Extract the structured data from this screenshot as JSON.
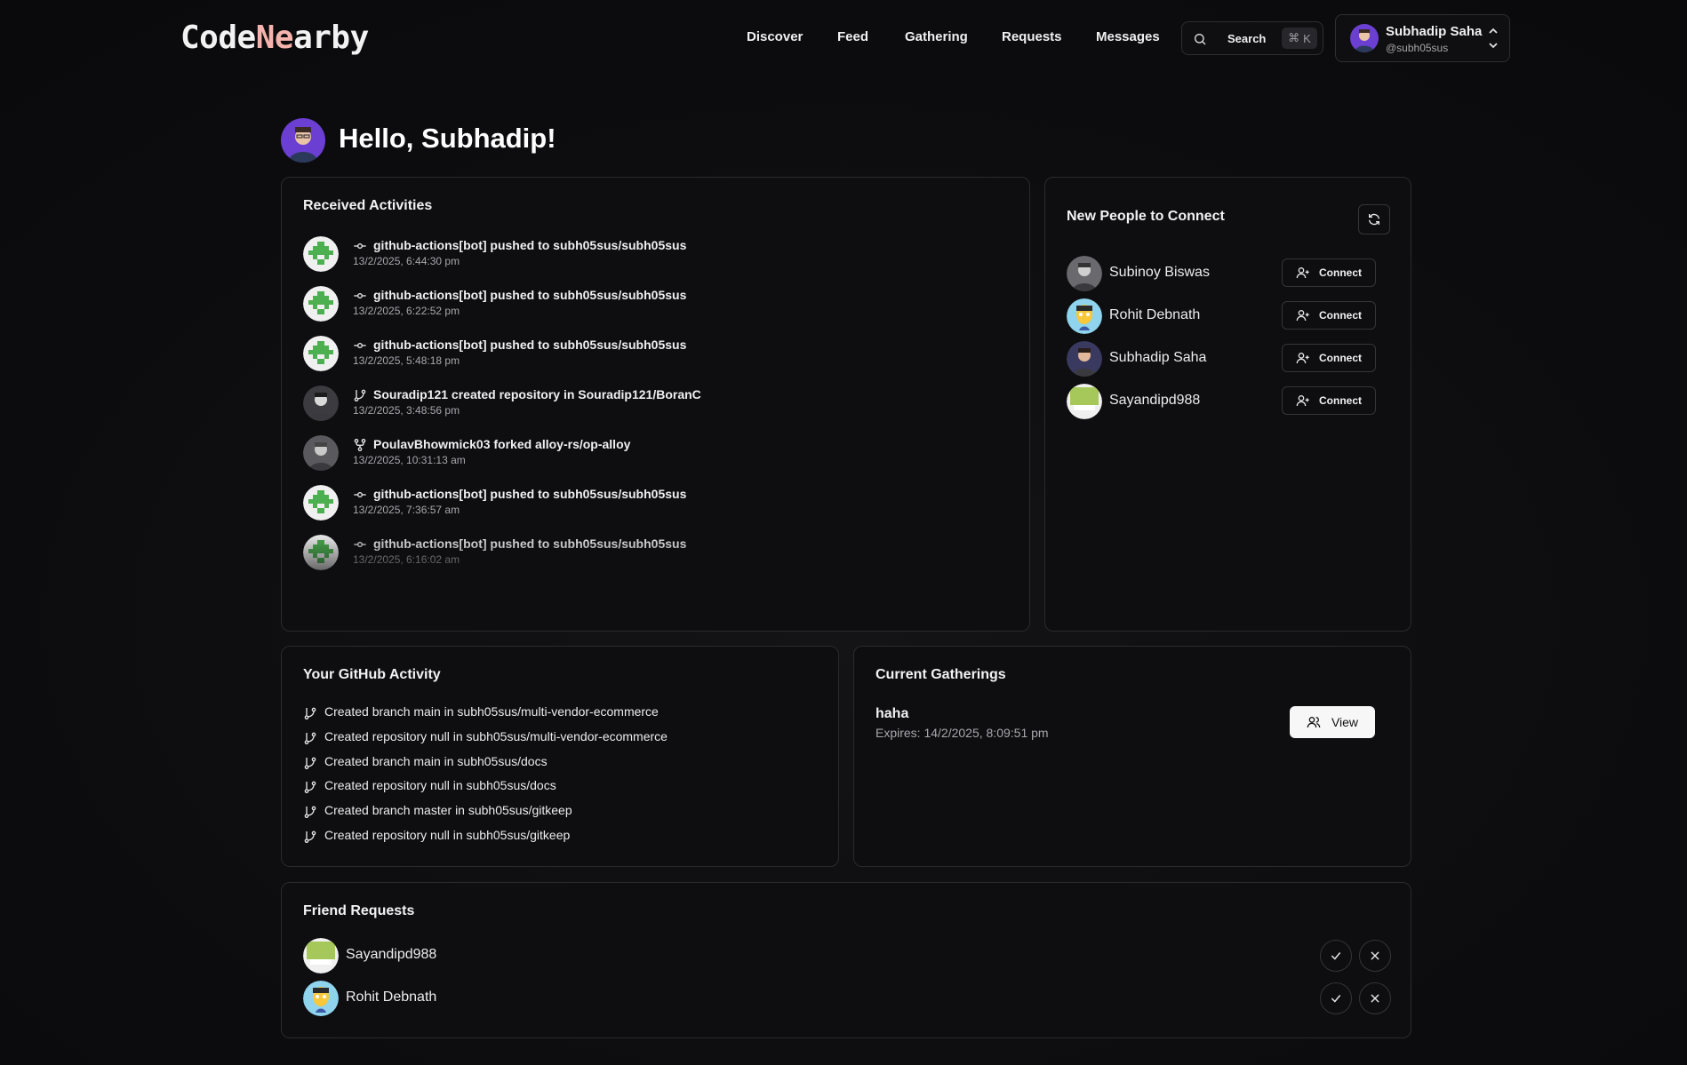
{
  "header": {
    "logo_prefix": "Code",
    "logo_accent": "Ne",
    "logo_suffix": "arby",
    "nav": [
      "Discover",
      "Feed",
      "Gathering",
      "Requests",
      "Messages"
    ],
    "search_label": "Search",
    "search_shortcut": "K",
    "user_name": "Subhadip Saha",
    "user_handle": "@subh05sus"
  },
  "greeting": "Hello, Subhadip!",
  "received": {
    "title": "Received Activities",
    "items": [
      {
        "text": "github-actions[bot] pushed to subh05sus/subh05sus",
        "time": "13/2/2025, 6:44:30 pm",
        "icon": "commit-icon"
      },
      {
        "text": "github-actions[bot] pushed to subh05sus/subh05sus",
        "time": "13/2/2025, 6:22:52 pm",
        "icon": "commit-icon"
      },
      {
        "text": "github-actions[bot] pushed to subh05sus/subh05sus",
        "time": "13/2/2025, 5:48:18 pm",
        "icon": "commit-icon"
      },
      {
        "text": "Souradip121 created repository in Souradip121/BoranC",
        "time": "13/2/2025, 3:48:56 pm",
        "icon": "branch-icon"
      },
      {
        "text": "PoulavBhowmick03 forked alloy-rs/op-alloy",
        "time": "13/2/2025, 10:31:13 am",
        "icon": "fork-icon"
      },
      {
        "text": "github-actions[bot] pushed to subh05sus/subh05sus",
        "time": "13/2/2025, 7:36:57 am",
        "icon": "commit-icon"
      },
      {
        "text": "github-actions[bot] pushed to subh05sus/subh05sus",
        "time": "13/2/2025, 6:16:02 am",
        "icon": "commit-icon"
      }
    ]
  },
  "people": {
    "title": "New People to Connect",
    "connect_label": "Connect",
    "items": [
      "Subinoy Biswas",
      "Rohit Debnath",
      "Subhadip Saha",
      "Sayandipd988"
    ]
  },
  "github": {
    "title": "Your GitHub Activity",
    "items": [
      "Created branch main in subh05sus/multi-vendor-ecommerce",
      "Created repository null in subh05sus/multi-vendor-ecommerce",
      "Created branch main in subh05sus/docs",
      "Created repository null in subh05sus/docs",
      "Created branch master in subh05sus/gitkeep",
      "Created repository null in subh05sus/gitkeep"
    ]
  },
  "gatherings": {
    "title": "Current Gatherings",
    "name": "haha",
    "expires": "Expires: 14/2/2025, 8:09:51 pm",
    "view_label": "View"
  },
  "friends": {
    "title": "Friend Requests",
    "items": [
      "Sayandipd988",
      "Rohit Debnath"
    ]
  },
  "colors": {
    "accent": "#f6b3ad",
    "background": "#0d0d0f",
    "card_border": "#2a2a2f"
  }
}
